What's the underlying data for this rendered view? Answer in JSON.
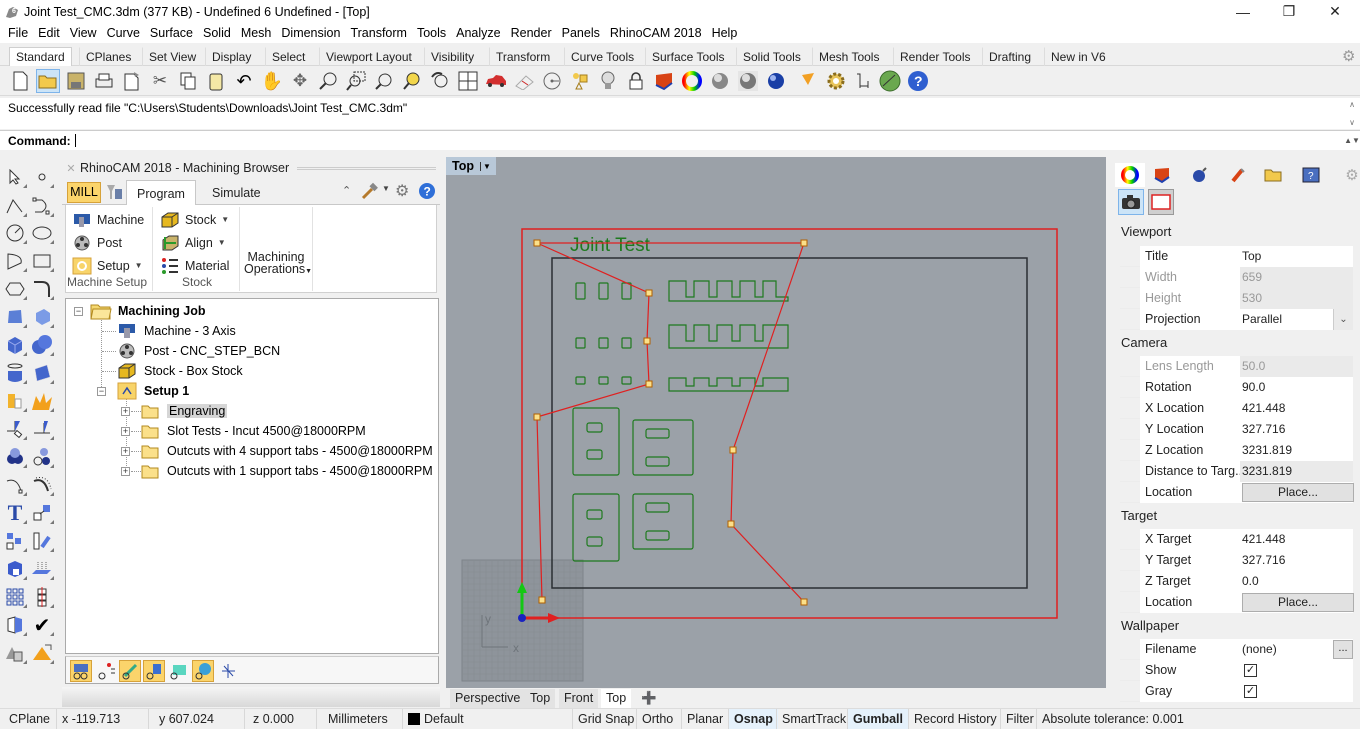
{
  "window": {
    "title": "Joint Test_CMC.3dm (377 KB) - Undefined 6 Undefined - [Top]",
    "controls": [
      "minimize",
      "restore",
      "close"
    ]
  },
  "menu": [
    "File",
    "Edit",
    "View",
    "Curve",
    "Surface",
    "Solid",
    "Mesh",
    "Dimension",
    "Transform",
    "Tools",
    "Analyze",
    "Render",
    "Panels",
    "RhinoCAM 2018",
    "Help"
  ],
  "toolbar_tabs": [
    "Standard",
    "CPlanes",
    "Set View",
    "Display",
    "Select",
    "Viewport Layout",
    "Visibility",
    "Transform",
    "Curve Tools",
    "Surface Tools",
    "Solid Tools",
    "Mesh Tools",
    "Render Tools",
    "Drafting",
    "New in V6"
  ],
  "active_toolbar_tab": "Standard",
  "toolbar_icons": [
    "new-document",
    "open",
    "save",
    "print",
    "import",
    "cut",
    "copy",
    "paste",
    "undo",
    "pan",
    "rotate-view",
    "zoom-dynamic",
    "zoom-window",
    "zoom-extents",
    "zoom-selected",
    "undo-view",
    "four-viewports",
    "car",
    "cplane",
    "circle-grid",
    "select-filter",
    "light-bulb",
    "lock",
    "layer",
    "color-wheel",
    "shaded-sphere",
    "ghosted-sphere",
    "rendered-sphere",
    "render",
    "gear-options",
    "dimension",
    "globe",
    "help"
  ],
  "command": {
    "history": "Successfully read file \"C:\\Users\\Students\\Downloads\\Joint Test_CMC.3dm\"",
    "prompt": "Command:",
    "value": ""
  },
  "rhinocam": {
    "title": "RhinoCAM 2018 - Machining Browser",
    "mode": "MILL",
    "tabs": [
      "Program",
      "Simulate"
    ],
    "active_tab": "Program",
    "ribbon": {
      "machine_setup": {
        "label": "Machine Setup",
        "items": [
          "Machine",
          "Post",
          "Setup"
        ]
      },
      "stock": {
        "label": "Stock",
        "items": [
          "Stock",
          "Align",
          "Material"
        ]
      },
      "machining_ops": {
        "line1": "Machining",
        "line2": "Operations"
      }
    },
    "tree": {
      "root": "Machining Job",
      "children": [
        "Machine - 3 Axis",
        "Post - CNC_STEP_BCN",
        "Stock - Box Stock"
      ],
      "setup": "Setup 1",
      "operations": [
        "Engraving",
        "Slot Tests - Incut 4500@18000RPM",
        "Outcuts with 4 support tabs - 4500@18000RPM",
        "Outcuts with 1 support tabs - 4500@18000RPM"
      ],
      "selected": "Engraving"
    }
  },
  "viewport": {
    "name": "Top",
    "drawing_text": "Joint Test",
    "axis_x": "x",
    "axis_y": "y",
    "colors": {
      "toolpath": "#e02020",
      "geometry": "#1e7a1e",
      "stock": "#2a2e33",
      "background": "#9ba1a8"
    },
    "tabs": [
      "Perspective",
      "Top",
      "Front",
      "Top"
    ],
    "active_tab_index": 3
  },
  "properties": {
    "viewport": {
      "header": "Viewport",
      "title": {
        "label": "Title",
        "value": "Top"
      },
      "width": {
        "label": "Width",
        "value": "659"
      },
      "height": {
        "label": "Height",
        "value": "530"
      },
      "projection": {
        "label": "Projection",
        "value": "Parallel"
      }
    },
    "camera": {
      "header": "Camera",
      "lens": {
        "label": "Lens Length",
        "value": "50.0"
      },
      "rotation": {
        "label": "Rotation",
        "value": "90.0"
      },
      "x": {
        "label": "X Location",
        "value": "421.448"
      },
      "y": {
        "label": "Y Location",
        "value": "327.716"
      },
      "z": {
        "label": "Z Location",
        "value": "3231.819"
      },
      "dist": {
        "label": "Distance to Targ...",
        "value": "3231.819"
      },
      "location": {
        "label": "Location",
        "button": "Place..."
      }
    },
    "target": {
      "header": "Target",
      "x": {
        "label": "X Target",
        "value": "421.448"
      },
      "y": {
        "label": "Y Target",
        "value": "327.716"
      },
      "z": {
        "label": "Z Target",
        "value": "0.0"
      },
      "location": {
        "label": "Location",
        "button": "Place..."
      }
    },
    "wallpaper": {
      "header": "Wallpaper",
      "filename": {
        "label": "Filename",
        "value": "(none)",
        "button": "..."
      },
      "show": {
        "label": "Show",
        "checked": true
      },
      "gray": {
        "label": "Gray",
        "checked": true
      }
    }
  },
  "status": {
    "cplane": "CPlane",
    "x": "x -119.713",
    "y": "y 607.024",
    "z": "z 0.000",
    "units": "Millimeters",
    "layer": "Default",
    "toggles": [
      {
        "label": "Grid Snap",
        "on": false
      },
      {
        "label": "Ortho",
        "on": false
      },
      {
        "label": "Planar",
        "on": false
      },
      {
        "label": "Osnap",
        "on": true
      },
      {
        "label": "SmartTrack",
        "on": false
      },
      {
        "label": "Gumball",
        "on": true
      },
      {
        "label": "Record History",
        "on": false
      },
      {
        "label": "Filter",
        "on": false
      }
    ],
    "tolerance": "Absolute tolerance: 0.001"
  }
}
